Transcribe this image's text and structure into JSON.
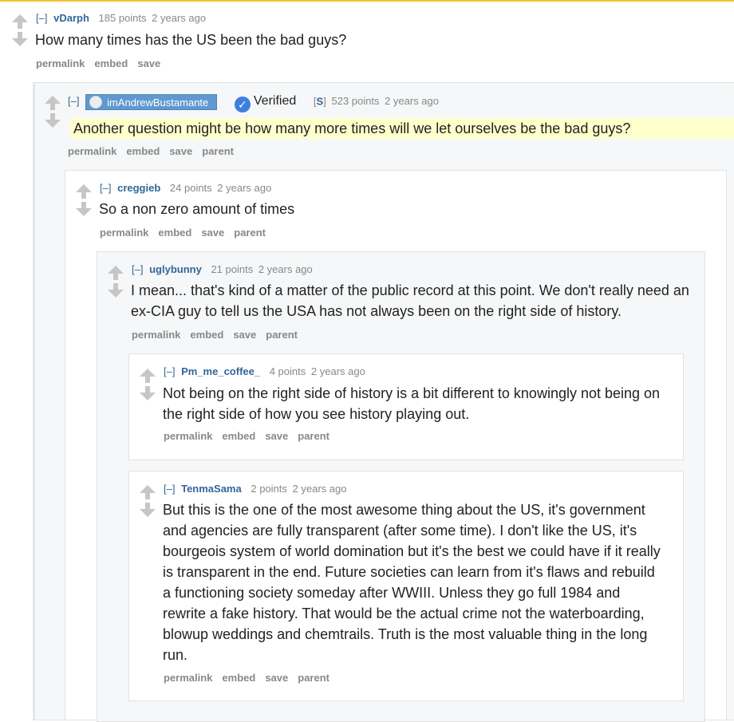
{
  "actions": {
    "permalink": "permalink",
    "embed": "embed",
    "save": "save",
    "parent": "parent"
  },
  "collapse_label": "[–]",
  "comments": [
    {
      "author": "vDarph",
      "points": "185 points",
      "age": "2 years ago",
      "text": "How many times has the US been the bad guys?"
    },
    {
      "author": "imAndrewBustamante",
      "verified_label": "Verified",
      "badge_prefix": "[",
      "badge_letter": "S",
      "badge_suffix": "]",
      "points": "523 points",
      "age": "2 years ago",
      "text": "Another question might be how many more times will we let ourselves be the bad guys?"
    },
    {
      "author": "creggieb",
      "points": "24 points",
      "age": "2 years ago",
      "text": "So a non zero amount of times"
    },
    {
      "author": "uglybunny",
      "points": "21 points",
      "age": "2 years ago",
      "text": "I mean... that's kind of a matter of the public record at this point. We don't really need an ex-CIA guy to tell us the USA has not always been on the right side of history."
    },
    {
      "author": "Pm_me_coffee_",
      "points": "4 points",
      "age": "2 years ago",
      "text": "Not being on the right side of history is a bit different to knowingly not being on the right side of how you see history playing out."
    },
    {
      "author": "TenmaSama",
      "points": "2 points",
      "age": "2 years ago",
      "text": "But this is the one of the most awesome thing about the US, it's government and agencies are fully transparent (after some time). I don't like the US, it's bourgeois system of world domination but it's the best we could have if it really is transparent in the end. Future societies can learn from it's flaws and rebuild a functioning society someday after WWIII. Unless they go full 1984 and rewrite a fake history. That would be the actual crime not the waterboarding, blowup weddings and chemtrails. Truth is the most valuable thing in the long run."
    }
  ],
  "colors": {
    "author": "#336699",
    "meta": "#888888",
    "highlight": "#ffffcc",
    "flair": "#5f99cf",
    "verified": "#3d7fe0",
    "topline": "#f2c230"
  },
  "icons": {
    "upvote": "upvote-arrow-icon",
    "downvote": "downvote-arrow-icon",
    "verified": "verified-check-icon",
    "avatar": "user-avatar-icon"
  }
}
